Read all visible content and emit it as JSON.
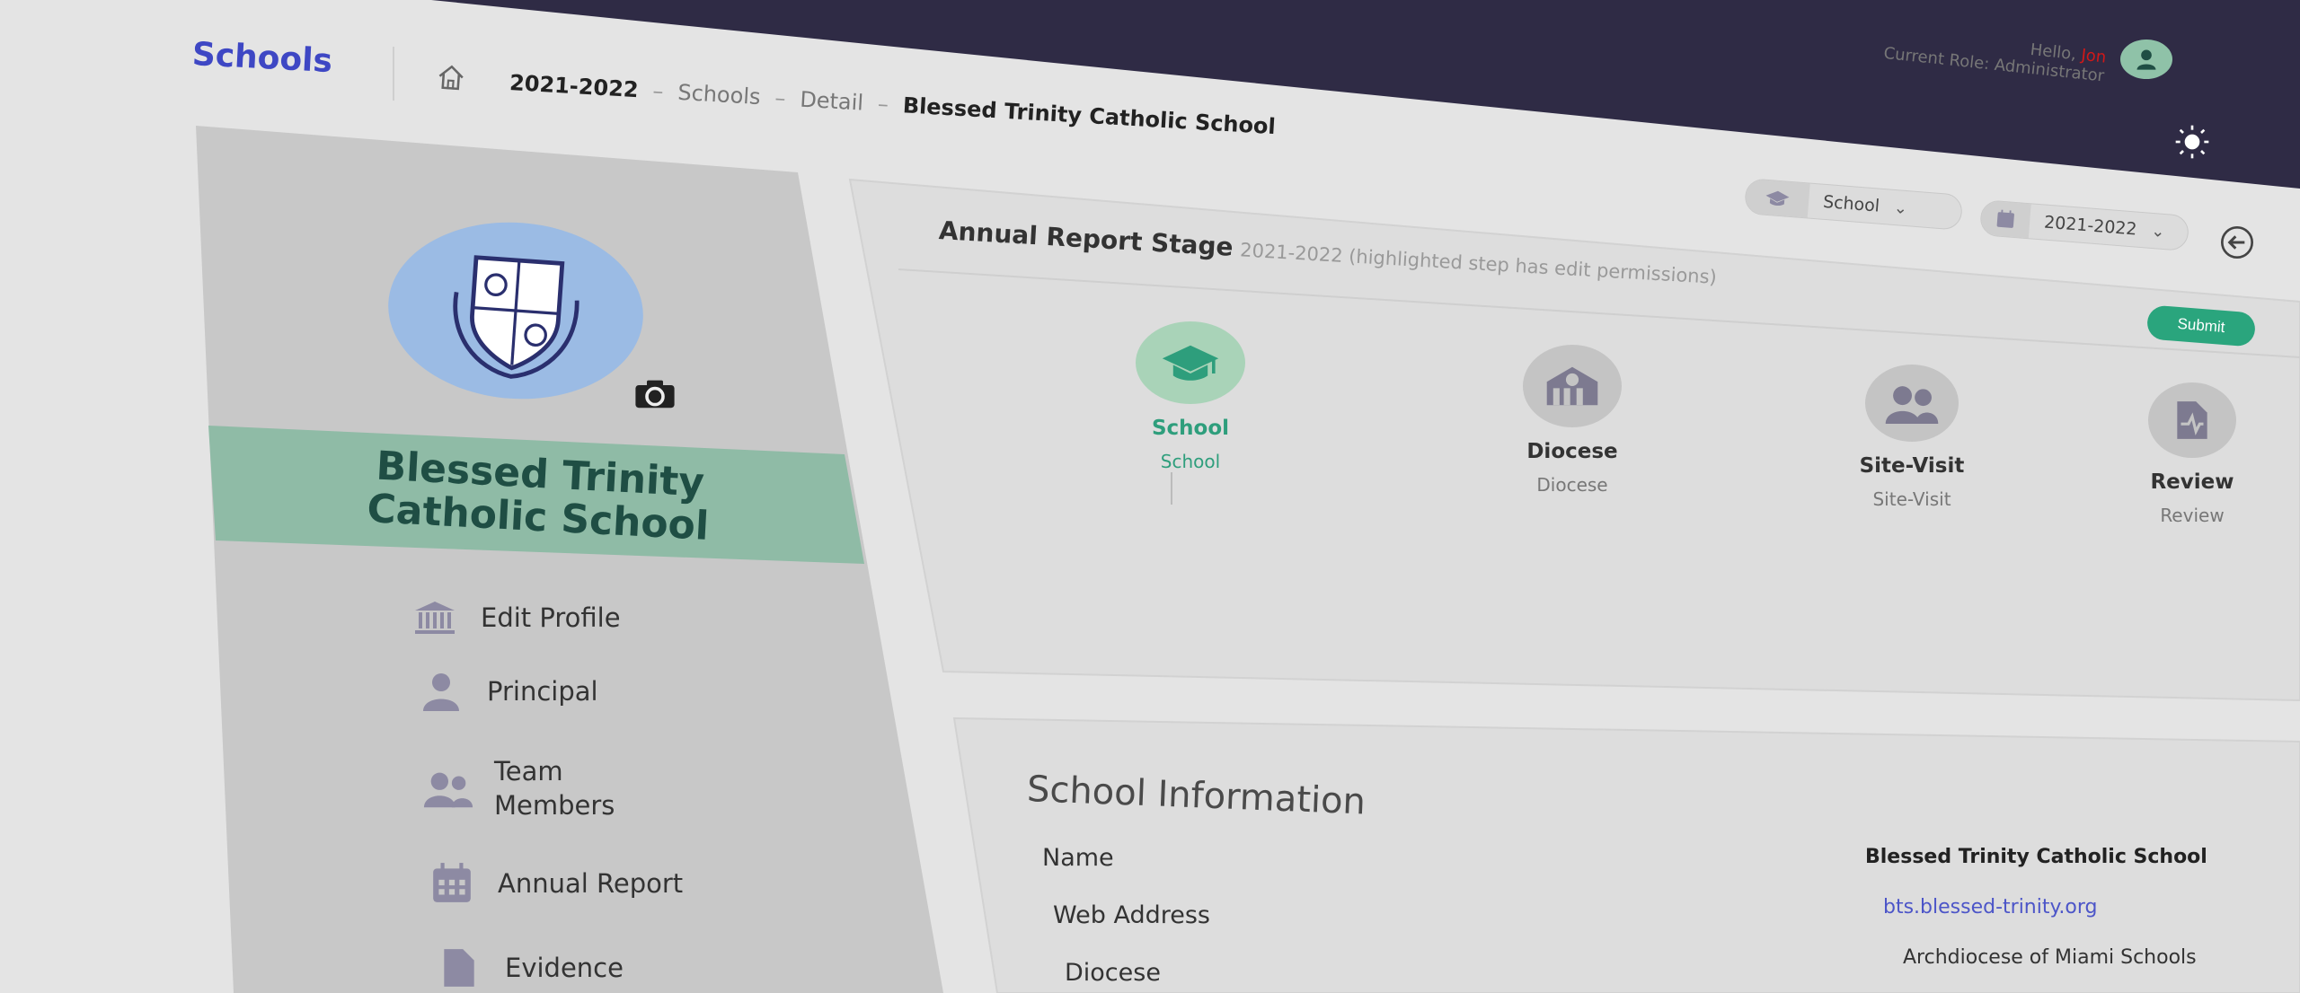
{
  "header": {
    "brand": "Schools",
    "breadcrumb": [
      "2021-2022",
      "Schools",
      "Detail",
      "Blessed Trinity Catholic School"
    ],
    "greeting_prefix": "Hello, ",
    "user_name": "Jon",
    "current_role": "Current Role: Administrator",
    "colors": {
      "topbar": "#2f2b45",
      "brand": "#3e47c4",
      "accent": "#2aa57d"
    }
  },
  "sidebar": {
    "school_name": "Blessed Trinity Catholic School",
    "menu": [
      {
        "label": "Edit Profile",
        "icon": "bank-icon"
      },
      {
        "label": "Principal",
        "icon": "person-icon"
      },
      {
        "label": "Team Members",
        "icon": "group-icon"
      },
      {
        "label": "Annual Report",
        "icon": "calendar-icon"
      },
      {
        "label": "Evidence",
        "icon": "document-icon"
      }
    ]
  },
  "stage": {
    "title": "Annual Report Stage",
    "subtitle": "2021-2022 (highlighted step has edit permissions)",
    "filters": {
      "type": "School",
      "year": "2021-2022"
    },
    "submit_label": "Submit",
    "steps": [
      {
        "label": "School",
        "sub": "School",
        "icon": "graduation-cap-icon",
        "active": true
      },
      {
        "label": "Diocese",
        "sub": "Diocese",
        "icon": "church-icon",
        "active": false
      },
      {
        "label": "Site-Visit",
        "sub": "Site-Visit",
        "icon": "group-icon",
        "active": false
      },
      {
        "label": "Review",
        "sub": "Review",
        "icon": "review-document-icon",
        "active": false
      }
    ]
  },
  "info": {
    "title": "School Information",
    "rows": [
      {
        "key": "Name",
        "value": "Blessed Trinity Catholic School"
      },
      {
        "key": "Web Address",
        "value": "bts.blessed-trinity.org"
      },
      {
        "key": "Diocese",
        "value": "Archdiocese of Miami Schools"
      }
    ]
  }
}
